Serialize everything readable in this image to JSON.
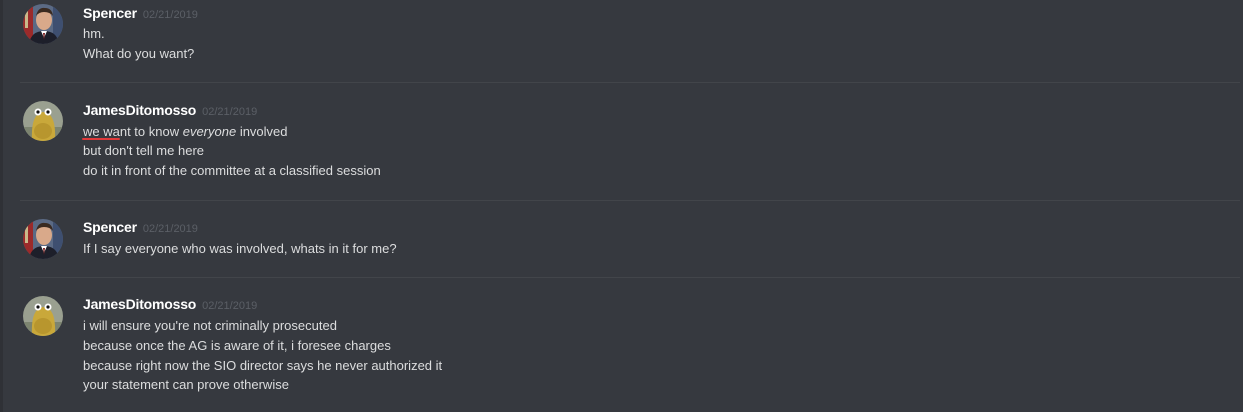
{
  "messages": [
    {
      "username": "Spencer",
      "timestamp": "02/21/2019",
      "avatar": "reagan-portrait-avatar",
      "lines": [
        "hm.",
        "What do you want?"
      ]
    },
    {
      "username": "JamesDitomosso",
      "timestamp": "02/21/2019",
      "avatar": "yellow-creature-avatar",
      "lines_rich": {
        "l1_before": "we want to know ",
        "l1_em": "everyone",
        "l1_after": " involved"
      },
      "lines": [
        "but don't tell me here",
        "do it in front of the committee at a classified session"
      ]
    },
    {
      "username": "Spencer",
      "timestamp": "02/21/2019",
      "avatar": "reagan-portrait-avatar",
      "lines": [
        "If I say everyone who was involved, whats in it for me?"
      ]
    },
    {
      "username": "JamesDitomosso",
      "timestamp": "02/21/2019",
      "avatar": "yellow-creature-avatar",
      "lines": [
        "i will ensure you're not criminally prosecuted",
        "because once the AG is aware of it, i foresee charges",
        "because right now the SIO director says he never authorized it",
        "your statement can prove otherwise"
      ]
    }
  ],
  "colors": {
    "background": "#36393f",
    "username": "#ffffff",
    "timestamp": "#5b5f66",
    "text": "#dcddde",
    "divider": "#42454a",
    "annotation": "#e03a3a"
  }
}
